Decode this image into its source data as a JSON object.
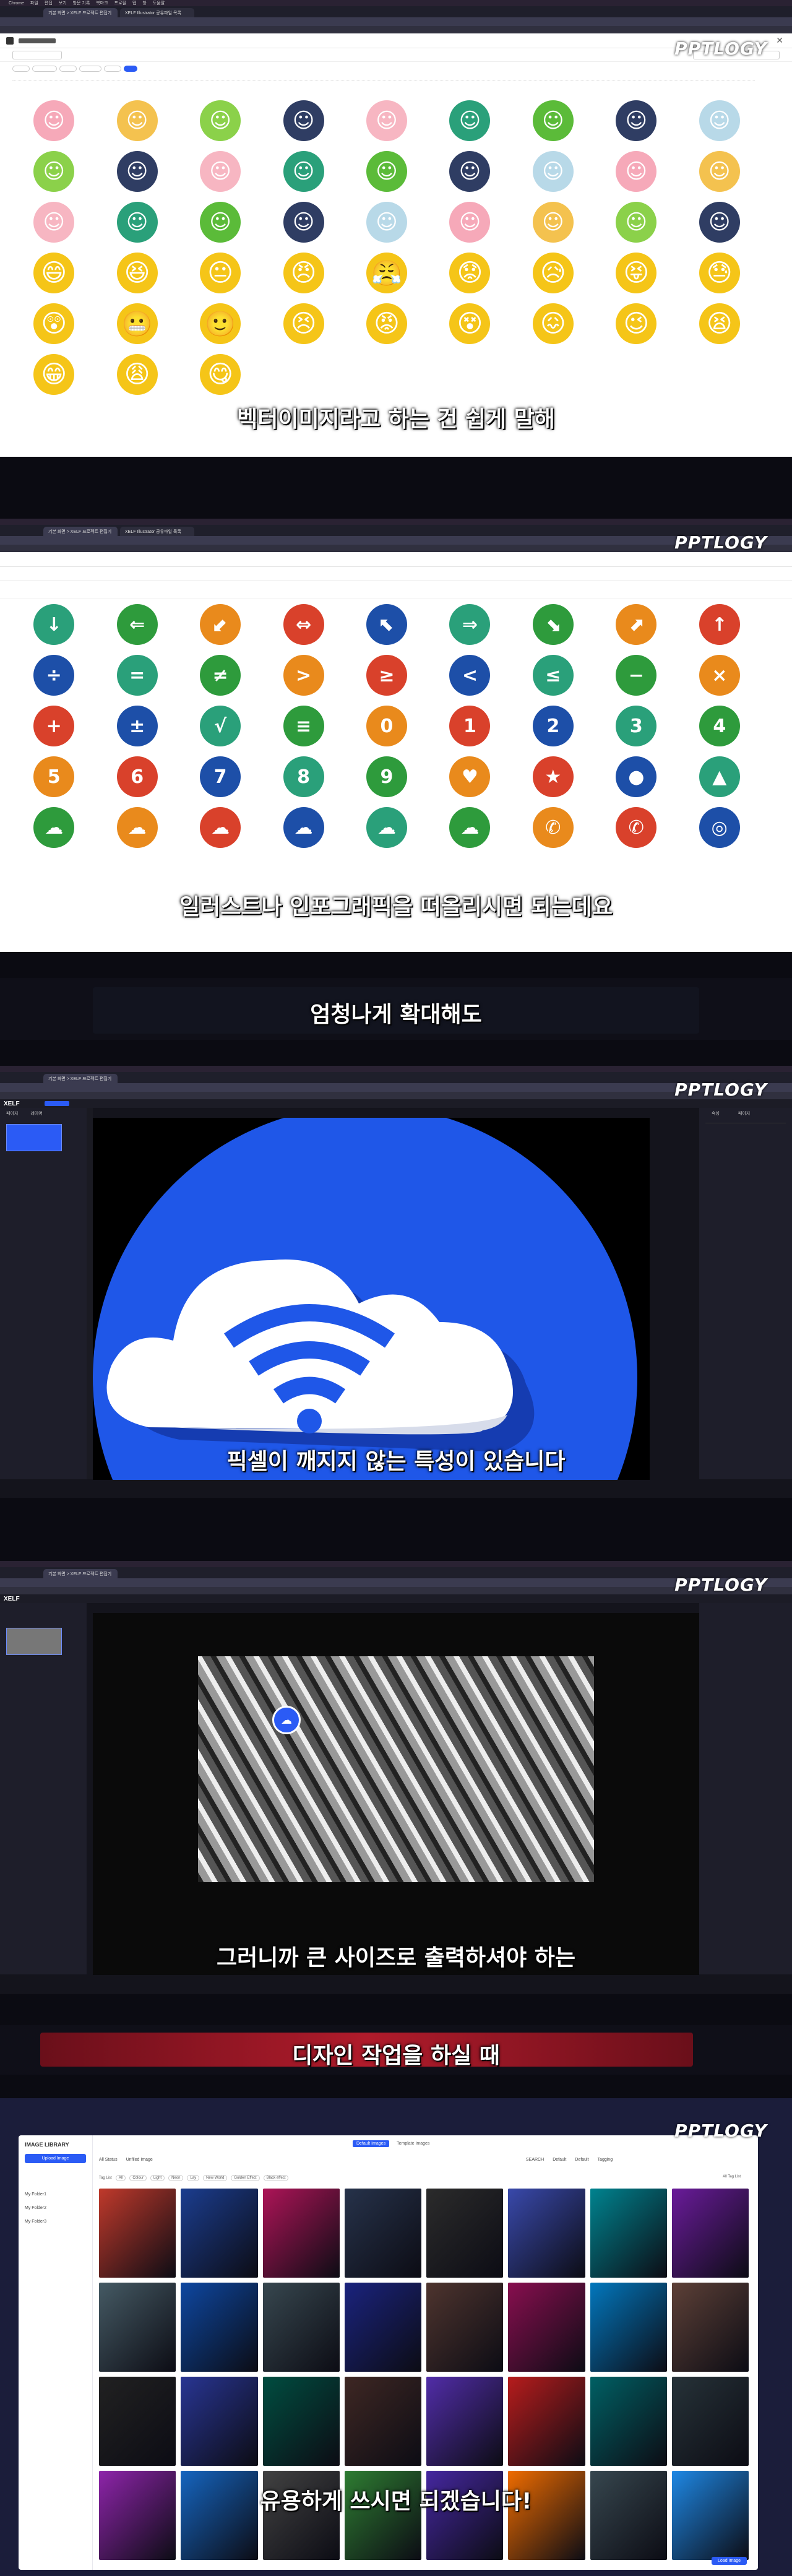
{
  "logo_text": "PPTLOGY",
  "subtitles": [
    "벡터이미지라고 하는 건 쉽게 말해",
    "일러스트나 인포그래픽을 떠올리시면 되는데요",
    "엄청나게 확대해도",
    "픽셀이 깨지지 않는 특성이 있습니다",
    "그러니까 큰 사이즈로 출력하셔야 하는",
    "디자인 작업을 하실 때",
    "유용하게 쓰시면 되겠습니다!"
  ],
  "browser": {
    "menu": [
      "Chrome",
      "파일",
      "편집",
      "보기",
      "방문 기록",
      "북마크",
      "프로필",
      "탭",
      "창",
      "도움말"
    ],
    "tabs": [
      "기본 화면 > XELF 프로젝트 편집기",
      "XELF Illustrator 공유파일 목록"
    ]
  },
  "editor": {
    "brand": "XELF",
    "panel_tabs": [
      "페이지",
      "레이어"
    ],
    "right_tabs": [
      "속성",
      "페이지"
    ]
  },
  "library": {
    "title": "IMAGE LIBRARY",
    "upload_label": "Upload Image",
    "folders": [
      "My Folder1",
      "My Folder2",
      "My Folder3"
    ],
    "top_tabs": [
      "Default Images",
      "Template Images"
    ],
    "tabs": [
      "All Status",
      "Unfiled Image"
    ],
    "tag_label": "Tag List",
    "tags": [
      "All",
      "Colour",
      "Light",
      "Neon",
      "Lay",
      "New World",
      "Golden Effect",
      "Black effect"
    ],
    "all_tag_label": "All Tag List",
    "search_label": "SEARCH",
    "sort": [
      "Default",
      "Default",
      "Tagging"
    ],
    "footer_button": "Load Image"
  },
  "colors": {
    "accent": "#2b5bf5",
    "red": "#d9412b",
    "green": "#2e9b3c",
    "blue": "#1d4fa8",
    "orange": "#e98a1c"
  }
}
